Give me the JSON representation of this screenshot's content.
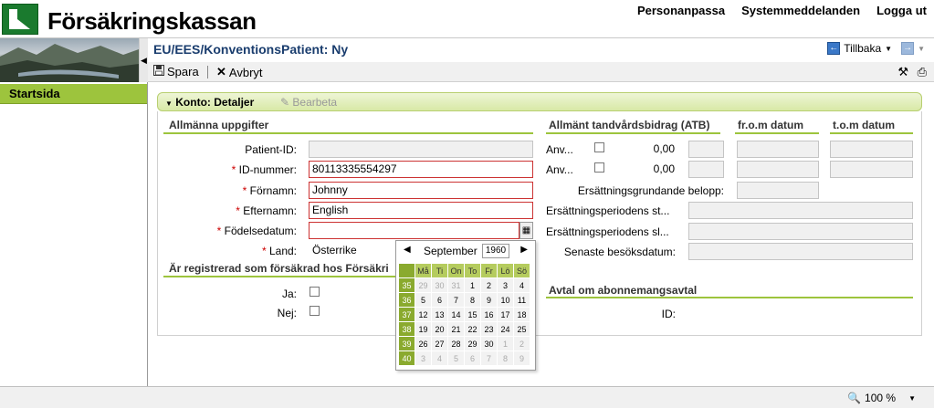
{
  "header": {
    "brand": "Försäkringskassan",
    "links": [
      "Personanpassa",
      "Systemmeddelanden",
      "Logga ut"
    ]
  },
  "title": {
    "page_title": "EU/EES/KonventionsPatient: Ny",
    "back_label": "Tillbaka"
  },
  "toolbar": {
    "save_label": "Spara",
    "cancel_label": "Avbryt"
  },
  "sidebar": {
    "items": [
      {
        "label": "Startsida"
      }
    ]
  },
  "panel": {
    "title": "Konto: Detaljer",
    "edit_label": "Bearbeta"
  },
  "general": {
    "section_title": "Allmänna uppgifter",
    "patient_id_label": "Patient-ID:",
    "patient_id_value": "",
    "id_number_label": "ID-nummer:",
    "id_number_value": "80113335554297",
    "first_name_label": "Förnamn:",
    "first_name_value": "Johnny",
    "last_name_label": "Efternamn:",
    "last_name_value": "English",
    "birthdate_label": "Födelsedatum:",
    "birthdate_value": "",
    "country_label": "Land:",
    "country_value": "Österrike"
  },
  "insured": {
    "section_title": "Är registrerad som försäkrad hos Försäkri",
    "yes_label": "Ja:",
    "no_label": "Nej:"
  },
  "atb": {
    "section_title": "Allmänt tandvårdsbidrag (ATB)",
    "from_header": "fr.o.m datum",
    "to_header": "t.o.m datum",
    "row1_label": "Anv...",
    "row1_amount": "0,00",
    "row2_label": "Anv...",
    "row2_amount": "0,00",
    "basis_label": "Ersättningsgrundande belopp:",
    "period_start_label": "Ersättningsperiodens st...",
    "period_end_label": "Ersättningsperiodens sl...",
    "last_visit_label": "Senaste besöksdatum:"
  },
  "subscription": {
    "section_title": "Avtal om abonnemangsavtal",
    "id_label": "ID:"
  },
  "calendar": {
    "month": "September",
    "year": "1960",
    "day_headers": [
      "Må",
      "Ti",
      "On",
      "To",
      "Fr",
      "Lö",
      "Sö"
    ],
    "weeks": [
      {
        "week": "35",
        "days": [
          {
            "d": "29",
            "other": true
          },
          {
            "d": "30",
            "other": true
          },
          {
            "d": "31",
            "other": true
          },
          {
            "d": "1"
          },
          {
            "d": "2"
          },
          {
            "d": "3"
          },
          {
            "d": "4"
          }
        ]
      },
      {
        "week": "36",
        "days": [
          {
            "d": "5"
          },
          {
            "d": "6"
          },
          {
            "d": "7"
          },
          {
            "d": "8"
          },
          {
            "d": "9"
          },
          {
            "d": "10"
          },
          {
            "d": "11"
          }
        ]
      },
      {
        "week": "37",
        "days": [
          {
            "d": "12"
          },
          {
            "d": "13"
          },
          {
            "d": "14"
          },
          {
            "d": "15"
          },
          {
            "d": "16"
          },
          {
            "d": "17"
          },
          {
            "d": "18"
          }
        ]
      },
      {
        "week": "38",
        "days": [
          {
            "d": "19"
          },
          {
            "d": "20"
          },
          {
            "d": "21"
          },
          {
            "d": "22"
          },
          {
            "d": "23"
          },
          {
            "d": "24"
          },
          {
            "d": "25"
          }
        ]
      },
      {
        "week": "39",
        "days": [
          {
            "d": "26"
          },
          {
            "d": "27"
          },
          {
            "d": "28"
          },
          {
            "d": "29"
          },
          {
            "d": "30"
          },
          {
            "d": "1",
            "other": true
          },
          {
            "d": "2",
            "other": true
          }
        ]
      },
      {
        "week": "40",
        "days": [
          {
            "d": "3",
            "other": true
          },
          {
            "d": "4",
            "other": true
          },
          {
            "d": "5",
            "other": true
          },
          {
            "d": "6",
            "other": true
          },
          {
            "d": "7",
            "other": true
          },
          {
            "d": "8",
            "other": true
          },
          {
            "d": "9",
            "other": true
          }
        ]
      }
    ]
  },
  "status": {
    "zoom": "100 %"
  },
  "colors": {
    "accent_green": "#9dc43d",
    "brand_green": "#1a7a2e",
    "title_blue": "#1a3d6e",
    "error_red": "#cc3333"
  }
}
